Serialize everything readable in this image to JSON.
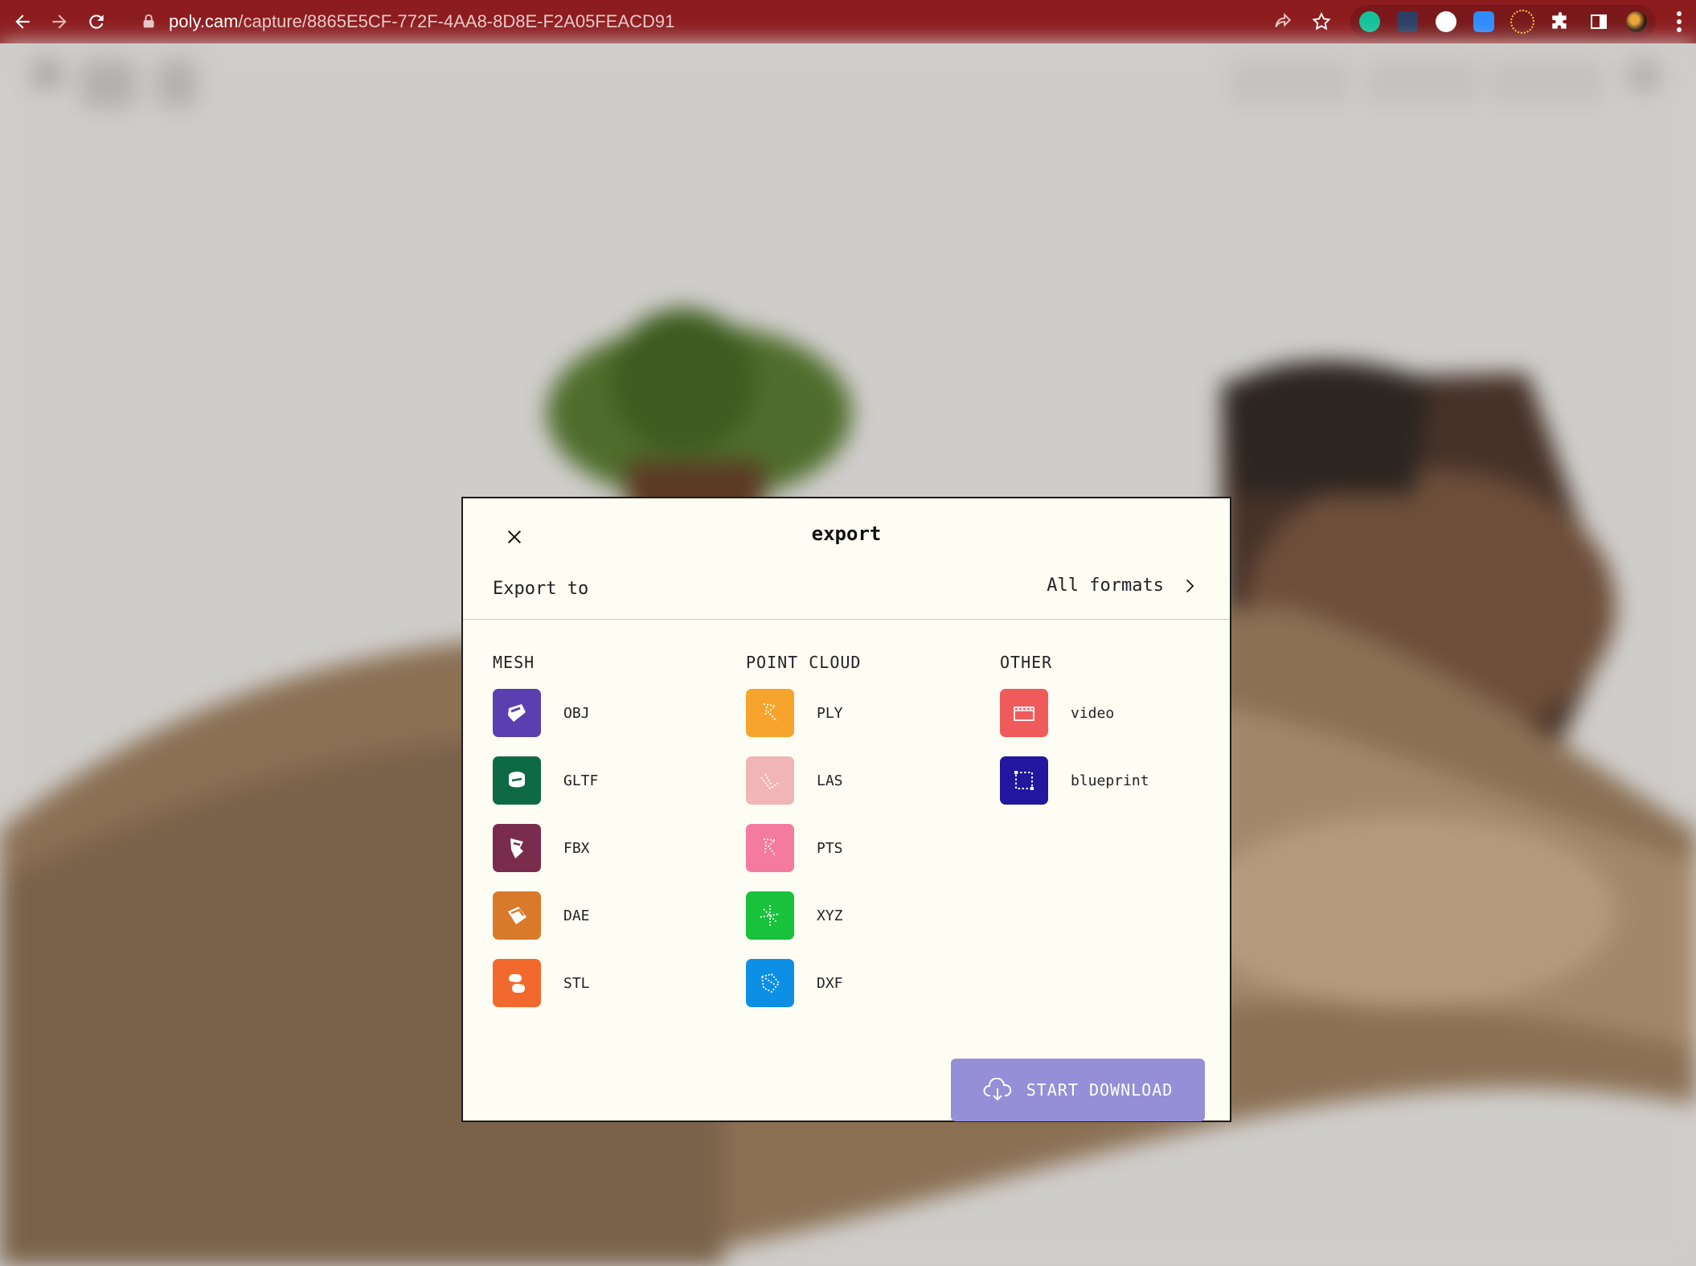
{
  "browser": {
    "url_host": "poly.cam",
    "url_path": "/capture/8865E5CF-772F-4AA8-8D8E-F2A05FEACD91",
    "chrome_color": "#8d1c1f"
  },
  "modal": {
    "title": "export",
    "export_to_label": "Export to",
    "all_formats_label": "All formats",
    "columns": {
      "mesh": {
        "heading": "MESH",
        "items": [
          {
            "label": "OBJ",
            "icon": "obj-icon",
            "color": "#5b3fb0"
          },
          {
            "label": "GLTF",
            "icon": "gltf-icon",
            "color": "#0e6a45"
          },
          {
            "label": "FBX",
            "icon": "fbx-icon",
            "color": "#7a2c4c"
          },
          {
            "label": "DAE",
            "icon": "dae-icon",
            "color": "#d9792a"
          },
          {
            "label": "STL",
            "icon": "stl-icon",
            "color": "#f2692e"
          }
        ]
      },
      "point_cloud": {
        "heading": "POINT CLOUD",
        "items": [
          {
            "label": "PLY",
            "icon": "ply-icon",
            "color": "#f7a42c"
          },
          {
            "label": "LAS",
            "icon": "las-icon",
            "color": "#f1b5b7"
          },
          {
            "label": "PTS",
            "icon": "pts-icon",
            "color": "#f47aa0"
          },
          {
            "label": "XYZ",
            "icon": "xyz-icon",
            "color": "#18c23a"
          },
          {
            "label": "DXF",
            "icon": "dxf-icon",
            "color": "#0d8fe6"
          }
        ]
      },
      "other": {
        "heading": "OTHER",
        "items": [
          {
            "label": "video",
            "icon": "video-icon",
            "color": "#ef5a5a"
          },
          {
            "label": "blueprint",
            "icon": "blueprint-icon",
            "color": "#22179e"
          }
        ]
      }
    },
    "download_label": "START DOWNLOAD",
    "download_color": "#948fd6"
  }
}
